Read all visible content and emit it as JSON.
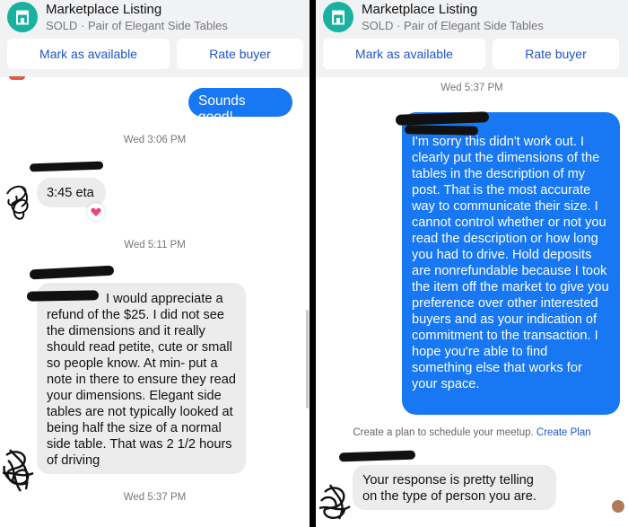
{
  "left": {
    "header": {
      "title": "Marketplace Listing",
      "subtitle": "SOLD · Pair of Elegant Side Tables",
      "mark_available": "Mark as available",
      "rate_buyer": "Rate buyer"
    },
    "messages": {
      "sent_1": "Sounds good!",
      "ts_1": "Wed 3:06 PM",
      "recv_1": "3:45 eta",
      "reaction": "heart-icon",
      "ts_2": "Wed 5:11 PM",
      "recv_2": "I would appreciate a refund of the $25. I did not see the dimensions and it really should read petite, cute or small so people know. At min- put a note in there to ensure they read your dimensions. Elegant side tables are not typically looked at being half the size of a normal side table. That was 2 1/2 hours of driving",
      "ts_3": "Wed 5:37 PM"
    }
  },
  "right": {
    "header": {
      "title": "Marketplace Listing",
      "subtitle": "SOLD · Pair of Elegant Side Tables",
      "mark_available": "Mark as available",
      "rate_buyer": "Rate buyer"
    },
    "messages": {
      "ts_1": "Wed 5:37 PM",
      "sent_1": "I'm sorry this didn't work out. I clearly put the dimensions of the tables in the description of my post. That is the most accurate way to communicate their size. I cannot control whether or not you read the description or how long you had to drive. Hold deposits are nonrefundable because I took the item off the market to give you preference over other interested buyers and as your indication of commitment to the transaction. I hope you're able to find something else that works for your space.",
      "plan_text": "Create a plan to schedule your meetup.",
      "plan_link": "Create Plan",
      "recv_1": "Your response is pretty telling on the type of person you are."
    }
  },
  "colors": {
    "accent": "#1877f2",
    "link": "#1f55c9",
    "header_bg": "#f1f2f4",
    "incoming_bubble": "#ececed",
    "store_icon_bg": "#19b1a0"
  }
}
